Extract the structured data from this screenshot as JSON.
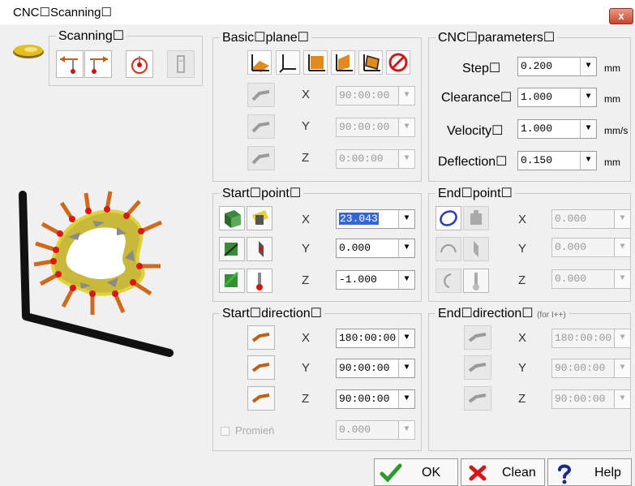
{
  "window": {
    "title": "CNC☐Scanning☐",
    "close_label": "x"
  },
  "scanning": {
    "title": "Scanning☐"
  },
  "basic_plane": {
    "title": "Basic☐plane☐",
    "axes": [
      {
        "axis": "X",
        "value": "90:00:00"
      },
      {
        "axis": "Y",
        "value": "90:00:00"
      },
      {
        "axis": "Z",
        "value": "0:00:00"
      }
    ]
  },
  "cnc_params": {
    "title": "CNC☐parameters☐",
    "rows": [
      {
        "label": "Step☐",
        "value": "0.200",
        "unit": "mm"
      },
      {
        "label": "Clearance☐",
        "value": "1.000",
        "unit": "mm"
      },
      {
        "label": "Velocity☐",
        "value": "1.000",
        "unit": "mm/s"
      },
      {
        "label": "Deflection☐",
        "value": "0.150",
        "unit": "mm"
      }
    ]
  },
  "start_point": {
    "title": "Start☐point☐",
    "axes": [
      {
        "axis": "X",
        "value": "23.043"
      },
      {
        "axis": "Y",
        "value": "0.000"
      },
      {
        "axis": "Z",
        "value": "-1.000"
      }
    ]
  },
  "end_point": {
    "title": "End☐point☐",
    "axes": [
      {
        "axis": "X",
        "value": "0.000"
      },
      {
        "axis": "Y",
        "value": "0.000"
      },
      {
        "axis": "Z",
        "value": "0.000"
      }
    ]
  },
  "start_direction": {
    "title": "Start☐direction☐",
    "axes": [
      {
        "axis": "X",
        "value": "180:00:00"
      },
      {
        "axis": "Y",
        "value": "90:00:00"
      },
      {
        "axis": "Z",
        "value": "90:00:00"
      }
    ],
    "promien_label": "Promień",
    "promien_value": "0.000"
  },
  "end_direction": {
    "title": "End☐direction☐",
    "note": "(for I++)",
    "axes": [
      {
        "axis": "X",
        "value": "180:00:00"
      },
      {
        "axis": "Y",
        "value": "90:00:00"
      },
      {
        "axis": "Z",
        "value": "90:00:00"
      }
    ]
  },
  "buttons": {
    "ok": "OK",
    "clean": "Clean",
    "help": "Help"
  },
  "dropdown_glyph": "▼"
}
